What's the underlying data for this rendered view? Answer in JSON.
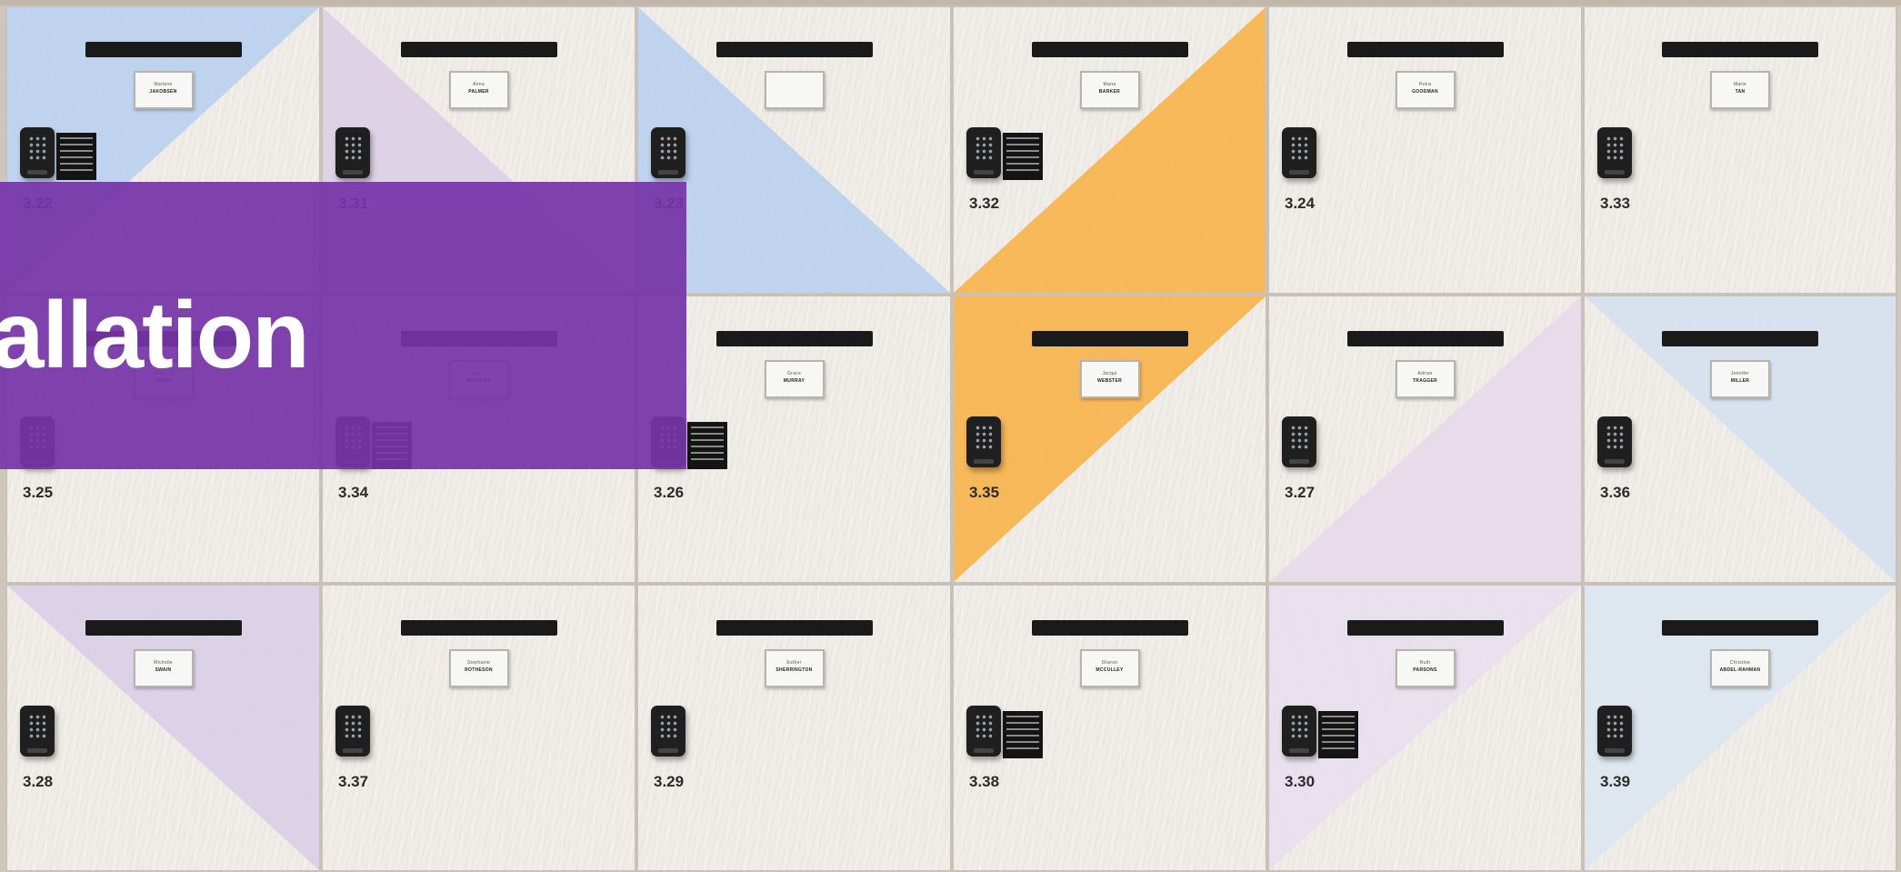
{
  "banner": {
    "text": "tallation"
  },
  "lockers": [
    {
      "number": "3.22",
      "first": "Marlene",
      "last": "JAKOBSEN",
      "accent": "#b9d0ee",
      "tri": "tl",
      "instr": true
    },
    {
      "number": "3.25",
      "first": "Rebecca",
      "last": "ODEH",
      "accent": "",
      "tri": "",
      "instr": false
    },
    {
      "number": "3.28",
      "first": "Michelle",
      "last": "SWAIN",
      "accent": "#d9cfe8",
      "tri": "tr",
      "instr": false
    },
    {
      "number": "3.31",
      "first": "Anna",
      "last": "PALMER",
      "accent": "#dccfe6",
      "tri": "bl",
      "instr": false
    },
    {
      "number": "3.34",
      "first": "Anne",
      "last": "MOSELEY",
      "accent": "",
      "tri": "",
      "instr": true
    },
    {
      "number": "3.37",
      "first": "Stephanie",
      "last": "ROTHESON",
      "accent": "",
      "tri": "",
      "instr": false
    },
    {
      "number": "3.23",
      "first": "",
      "last": "",
      "accent": "#b9d0ee",
      "tri": "bl",
      "instr": false
    },
    {
      "number": "3.26",
      "first": "Grace",
      "last": "MURRAY",
      "accent": "",
      "tri": "",
      "instr": true
    },
    {
      "number": "3.29",
      "first": "Esther",
      "last": "SHERRINGTON",
      "accent": "",
      "tri": "",
      "instr": false
    },
    {
      "number": "3.32",
      "first": "Maria",
      "last": "BARKER",
      "accent": "#f7b24a",
      "tri": "br",
      "instr": true
    },
    {
      "number": "3.35",
      "first": "Jacqui",
      "last": "WEBSTER",
      "accent": "#f7b24a",
      "tri": "tl",
      "instr": false
    },
    {
      "number": "3.38",
      "first": "Sharon",
      "last": "MCCULLEY",
      "accent": "",
      "tri": "",
      "instr": true
    },
    {
      "number": "3.24",
      "first": "Petra",
      "last": "GOODMAN",
      "accent": "",
      "tri": "",
      "instr": false
    },
    {
      "number": "3.27",
      "first": "Adrian",
      "last": "TRAGGER",
      "accent": "#e7d9ea",
      "tri": "br",
      "instr": false
    },
    {
      "number": "3.30",
      "first": "Ruth",
      "last": "PARSONS",
      "accent": "#e8dfee",
      "tri": "tl",
      "instr": true
    },
    {
      "number": "3.33",
      "first": "Marie",
      "last": "TAN",
      "accent": "",
      "tri": "",
      "instr": false
    },
    {
      "number": "3.36",
      "first": "Jennifer",
      "last": "MILLER",
      "accent": "#d5e1ee",
      "tri": "tr",
      "instr": false
    },
    {
      "number": "3.39",
      "first": "Christine",
      "last": "ABDEL-RAHMAN",
      "accent": "#dbe5ef",
      "tri": "tl",
      "instr": false
    }
  ]
}
